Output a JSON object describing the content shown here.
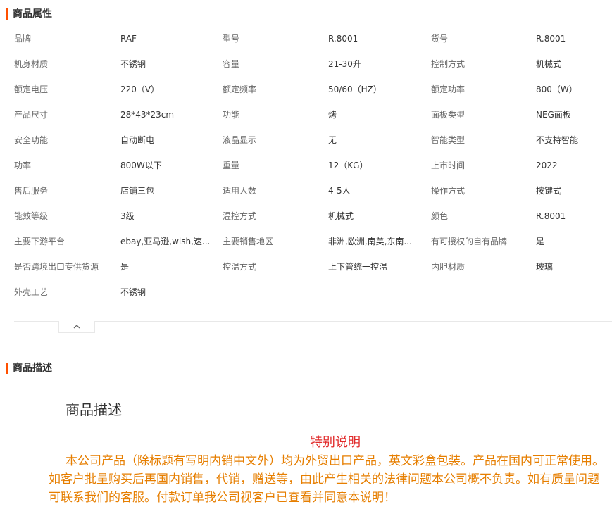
{
  "attributes_section": {
    "title": "商品属性",
    "rows": [
      [
        {
          "name": "品牌",
          "value": "RAF"
        },
        {
          "name": "型号",
          "value": "R.8001"
        },
        {
          "name": "货号",
          "value": "R.8001"
        }
      ],
      [
        {
          "name": "机身材质",
          "value": "不锈钢"
        },
        {
          "name": "容量",
          "value": "21-30升"
        },
        {
          "name": "控制方式",
          "value": "机械式"
        }
      ],
      [
        {
          "name": "额定电压",
          "value": "220（V）"
        },
        {
          "name": "额定频率",
          "value": "50/60（HZ）"
        },
        {
          "name": "额定功率",
          "value": "800（W）"
        }
      ],
      [
        {
          "name": "产品尺寸",
          "value": "28*43*23cm"
        },
        {
          "name": "功能",
          "value": "烤"
        },
        {
          "name": "面板类型",
          "value": "NEG面板"
        }
      ],
      [
        {
          "name": "安全功能",
          "value": "自动断电"
        },
        {
          "name": "液晶显示",
          "value": "无"
        },
        {
          "name": "智能类型",
          "value": "不支持智能"
        }
      ],
      [
        {
          "name": "功率",
          "value": "800W以下"
        },
        {
          "name": "重量",
          "value": "12（KG）"
        },
        {
          "name": "上市时间",
          "value": "2022"
        }
      ],
      [
        {
          "name": "售后服务",
          "value": "店铺三包"
        },
        {
          "name": "适用人数",
          "value": "4-5人"
        },
        {
          "name": "操作方式",
          "value": "按键式"
        }
      ],
      [
        {
          "name": "能效等级",
          "value": "3级"
        },
        {
          "name": "温控方式",
          "value": "机械式"
        },
        {
          "name": "颜色",
          "value": "R.8001"
        }
      ],
      [
        {
          "name": "主要下游平台",
          "value": "ebay,亚马逊,wish,速..."
        },
        {
          "name": "主要销售地区",
          "value": "非洲,欧洲,南美,东南..."
        },
        {
          "name": "有可授权的自有品牌",
          "value": "是"
        }
      ],
      [
        {
          "name": "是否跨境出口专供货源",
          "value": "是"
        },
        {
          "name": "控温方式",
          "value": "上下管统一控温"
        },
        {
          "name": "内胆材质",
          "value": "玻璃"
        }
      ],
      [
        {
          "name": "外壳工艺",
          "value": "不锈钢"
        }
      ]
    ],
    "collapse_icon": "chevron-up-icon"
  },
  "description_section": {
    "title": "商品描述",
    "heading": "商品描述",
    "notice_title": "特别说明",
    "notice_body": "本公司产品（除标题有写明内销中文外）均为外贸出口产品，英文彩盒包装。产品在国内可正常使用。如客户批量购买后再国内销售，代销，赠送等，由此产生相关的法律问题本公司概不负责。如有质量问题可联系我们的客服。付款订单我公司视客户已查看并同意本说明！"
  },
  "colors": {
    "accent": "#ff5000",
    "notice_title": "#e12a2a",
    "notice_body": "#e67e00"
  }
}
